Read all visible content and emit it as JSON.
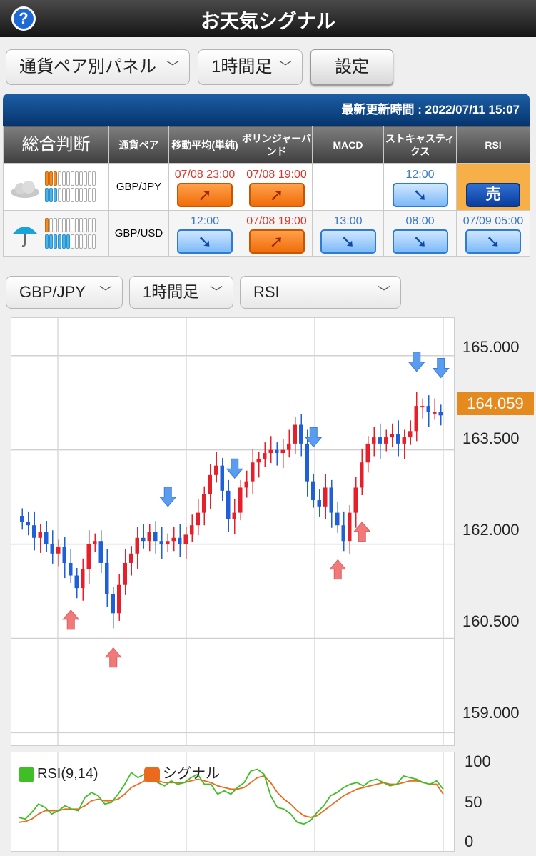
{
  "header": {
    "title": "お天気シグナル",
    "help_icon": "?"
  },
  "toolbar": {
    "panel_select": "通貨ペア別パネル",
    "timeframe_select": "1時間足",
    "settings_button": "設定"
  },
  "signal_table": {
    "updated": "最新更新時間 : 2022/07/11 15:07",
    "headers": [
      "総合判断",
      "通貨ペア",
      "移動平均(単純)",
      "ボリンジャーバンド",
      "MACD",
      "ストキャスティクス",
      "RSI"
    ],
    "rows": [
      {
        "weather": "cloud-icon",
        "pair": "GBP/JPY",
        "orange_bars": [
          3,
          0
        ],
        "blue_bars": [
          3,
          0
        ],
        "cells": [
          {
            "time": "07/08 23:00",
            "kind": "up",
            "time_color": "red"
          },
          {
            "time": "07/08 19:00",
            "kind": "up",
            "time_color": "red"
          },
          {
            "time": "",
            "kind": "none"
          },
          {
            "time": "12:00",
            "kind": "down",
            "time_color": "blue"
          },
          {
            "time": "",
            "kind": "sell",
            "label": "売",
            "highlight": true
          }
        ]
      },
      {
        "weather": "umbrella-icon",
        "pair": "GBP/USD",
        "cells": [
          {
            "time": "12:00",
            "kind": "down",
            "time_color": "blue"
          },
          {
            "time": "07/08 19:00",
            "kind": "up",
            "time_color": "red"
          },
          {
            "time": "13:00",
            "kind": "down",
            "time_color": "blue"
          },
          {
            "time": "08:00",
            "kind": "down",
            "time_color": "blue"
          },
          {
            "time": "07/09 05:00",
            "kind": "down",
            "time_color": "blue"
          }
        ]
      }
    ]
  },
  "chart_toolbar": {
    "pair_select": "GBP/JPY",
    "timeframe_select": "1時間足",
    "indicator_select": "RSI"
  },
  "colors": {
    "up_candle": "#e5202a",
    "down_candle": "#1f5fd8",
    "buy_arrow": "#f07a7a",
    "sell_arrow": "#5a9cf0",
    "rsi_line": "#3fbe26",
    "signal_line": "#ea6a1e",
    "current_price_bg": "#e58a1e"
  },
  "chart_data": [
    {
      "type": "candlestick",
      "y_ticks": [
        "165.000",
        "163.500",
        "162.000",
        "160.500",
        "159.000"
      ],
      "ylim": [
        158.8,
        165.6
      ],
      "current_price": "164.059",
      "grid": true,
      "close": [
        162.35,
        162.3,
        162.1,
        162.2,
        162.0,
        161.85,
        161.95,
        161.7,
        161.5,
        161.3,
        161.6,
        162.0,
        162.05,
        161.7,
        161.2,
        160.9,
        161.35,
        161.7,
        161.85,
        162.1,
        162.05,
        162.2,
        162.05,
        162.0,
        162.05,
        162.1,
        162.0,
        162.15,
        162.3,
        162.5,
        162.8,
        163.1,
        163.25,
        162.85,
        162.4,
        162.5,
        162.9,
        163.0,
        163.3,
        163.35,
        163.45,
        163.5,
        163.45,
        163.5,
        163.6,
        163.9,
        163.6,
        163.0,
        162.7,
        162.6,
        162.9,
        162.5,
        162.3,
        162.05,
        162.5,
        162.9,
        163.3,
        163.6,
        163.7,
        163.6,
        163.7,
        163.75,
        163.6,
        163.7,
        163.8,
        164.2,
        164.2,
        164.1,
        164.1,
        164.05
      ],
      "buy_signals": [
        8,
        15,
        52,
        56
      ],
      "sell_signals": [
        24,
        35,
        48,
        65,
        69
      ]
    },
    {
      "type": "line",
      "ylim": [
        0,
        100
      ],
      "y_ticks": [
        "100",
        "50",
        "0"
      ],
      "series": [
        {
          "name": "RSI(9,14)",
          "values": [
            32,
            30,
            38,
            48,
            44,
            36,
            40,
            46,
            42,
            40,
            56,
            62,
            58,
            48,
            50,
            60,
            72,
            86,
            80,
            84,
            78,
            74,
            70,
            76,
            72,
            74,
            80,
            84,
            72,
            72,
            60,
            64,
            60,
            68,
            74,
            88,
            90,
            84,
            58,
            44,
            42,
            36,
            26,
            24,
            28,
            38,
            46,
            58,
            62,
            68,
            72,
            74,
            70,
            76,
            78,
            74,
            70,
            72,
            82,
            80,
            78,
            74,
            72,
            76,
            66
          ]
        },
        {
          "name": "シグナル",
          "values": [
            26,
            27,
            30,
            36,
            40,
            40,
            40,
            42,
            42,
            42,
            46,
            52,
            54,
            52,
            52,
            54,
            60,
            68,
            72,
            76,
            78,
            76,
            74,
            74,
            74,
            74,
            76,
            78,
            76,
            74,
            70,
            68,
            66,
            66,
            68,
            74,
            80,
            82,
            74,
            62,
            54,
            48,
            40,
            34,
            32,
            34,
            40,
            46,
            52,
            58,
            62,
            66,
            68,
            70,
            72,
            74,
            72,
            72,
            74,
            76,
            76,
            74,
            72,
            72,
            60
          ]
        }
      ]
    }
  ]
}
